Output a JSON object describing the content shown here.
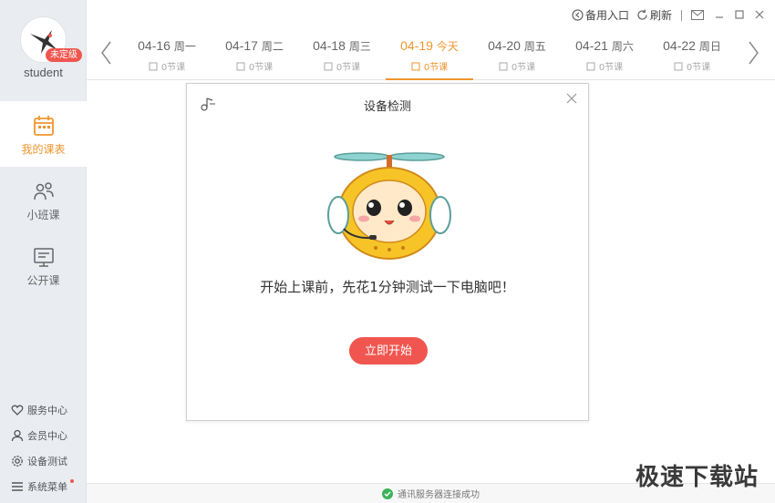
{
  "user": {
    "name": "student",
    "level_badge": "未定级"
  },
  "nav": [
    {
      "label": "我的课表",
      "icon": "calendar-icon",
      "active": true
    },
    {
      "label": "小班课",
      "icon": "group-icon",
      "active": false
    },
    {
      "label": "公开课",
      "icon": "board-icon",
      "active": false
    }
  ],
  "bottom_links": [
    {
      "label": "服务中心",
      "icon": "heart-icon"
    },
    {
      "label": "会员中心",
      "icon": "person-icon"
    },
    {
      "label": "设备测试",
      "icon": "gear-icon"
    },
    {
      "label": "系统菜单",
      "icon": "menu-icon"
    }
  ],
  "toolbar": {
    "backup_label": "备用入口",
    "refresh_label": "刷新"
  },
  "days": [
    {
      "date": "04-16",
      "weekday": "周一",
      "count": "0节课",
      "today": false
    },
    {
      "date": "04-17",
      "weekday": "周二",
      "count": "0节课",
      "today": false
    },
    {
      "date": "04-18",
      "weekday": "周三",
      "count": "0节课",
      "today": false
    },
    {
      "date": "04-19",
      "weekday": "今天",
      "count": "0节课",
      "today": true
    },
    {
      "date": "04-20",
      "weekday": "周五",
      "count": "0节课",
      "today": false
    },
    {
      "date": "04-21",
      "weekday": "周六",
      "count": "0节课",
      "today": false
    },
    {
      "date": "04-22",
      "weekday": "周日",
      "count": "0节课",
      "today": false
    }
  ],
  "modal": {
    "title": "设备检测",
    "message": "开始上课前，先花1分钟测试一下电脑吧！",
    "start_button": "立即开始"
  },
  "status": {
    "text": "通讯服务器连接成功"
  },
  "watermark": "极速下载站",
  "colors": {
    "accent": "#f0962e",
    "primary_red": "#f0564f",
    "sidebar_bg": "#e9edf2",
    "status_ok": "#3cb35a"
  }
}
